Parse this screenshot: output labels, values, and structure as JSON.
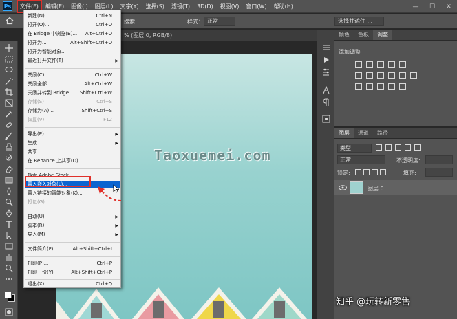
{
  "menubar": {
    "logo": "Ps",
    "items": [
      "文件(F)",
      "编辑(E)",
      "图像(I)",
      "图层(L)",
      "文字(Y)",
      "选择(S)",
      "滤镜(T)",
      "3D(D)",
      "视图(V)",
      "窗口(W)",
      "帮助(H)"
    ],
    "active_index": 0
  },
  "window_controls": [
    "—",
    "☐",
    "✕"
  ],
  "options_bar": {
    "search_partial": "搜索",
    "style_label": "样式：",
    "style_value": "正常",
    "select_mask_button": "选择并遮住 ..."
  },
  "document_tab": "% (图层 0, RGB/8)",
  "file_menu": [
    {
      "label": "新建(N)...",
      "shortcut": "Ctrl+N"
    },
    {
      "label": "打开(O)...",
      "shortcut": "Ctrl+O"
    },
    {
      "label": "在 Bridge 中浏览(B)...",
      "shortcut": "Alt+Ctrl+O"
    },
    {
      "label": "打开为...",
      "shortcut": "Alt+Shift+Ctrl+O"
    },
    {
      "label": "打开为智能对象...",
      "shortcut": ""
    },
    {
      "label": "最近打开文件(T)",
      "shortcut": "",
      "submenu": true
    },
    {
      "label": "关闭(C)",
      "shortcut": "Ctrl+W"
    },
    {
      "label": "关闭全部",
      "shortcut": "Alt+Ctrl+W"
    },
    {
      "label": "关闭并转到 Bridge...",
      "shortcut": "Shift+Ctrl+W"
    },
    {
      "label": "存储(S)",
      "shortcut": "Ctrl+S",
      "disabled": true
    },
    {
      "label": "存储为(A)...",
      "shortcut": "Shift+Ctrl+S"
    },
    {
      "label": "恢复(V)",
      "shortcut": "F12",
      "disabled": true
    },
    {
      "label": "导出(E)",
      "shortcut": "",
      "submenu": true
    },
    {
      "label": "生成",
      "shortcut": "",
      "submenu": true
    },
    {
      "label": "共享...",
      "shortcut": ""
    },
    {
      "label": "在 Behance 上共享(D)...",
      "shortcut": ""
    },
    {
      "label": "搜索 Adobe Stock...",
      "shortcut": ""
    },
    {
      "label": "置入嵌入对象(L)...",
      "shortcut": "",
      "highlighted": true
    },
    {
      "label": "置入链接的智能对象(K)...",
      "shortcut": ""
    },
    {
      "label": "打包(G)...",
      "shortcut": "",
      "disabled": true
    },
    {
      "label": "自动(U)",
      "shortcut": "",
      "submenu": true
    },
    {
      "label": "脚本(R)",
      "shortcut": "",
      "submenu": true
    },
    {
      "label": "导入(M)",
      "shortcut": "",
      "submenu": true
    },
    {
      "label": "文件简介(F)...",
      "shortcut": "Alt+Shift+Ctrl+I"
    },
    {
      "label": "打印(P)...",
      "shortcut": "Ctrl+P"
    },
    {
      "label": "打印一份(Y)",
      "shortcut": "Alt+Shift+Ctrl+P"
    },
    {
      "label": "退出(X)",
      "shortcut": "Ctrl+Q"
    }
  ],
  "canvas": {
    "watermark": "Taoxuemei.com"
  },
  "adjustments_panel": {
    "tabs": [
      "颜色",
      "色板",
      "调整"
    ],
    "active_tab": 2,
    "add_label": "添加调整"
  },
  "layers_panel": {
    "tabs": [
      "图层",
      "通道",
      "路径"
    ],
    "active_tab": 0,
    "kind_filter": "类型",
    "blend_mode": "正常",
    "opacity_label": "不透明度:",
    "lock_label": "锁定:",
    "fill_label": "填充:",
    "layer_name": "图层 0"
  },
  "footer_watermark": "知乎 @玩转新零售"
}
